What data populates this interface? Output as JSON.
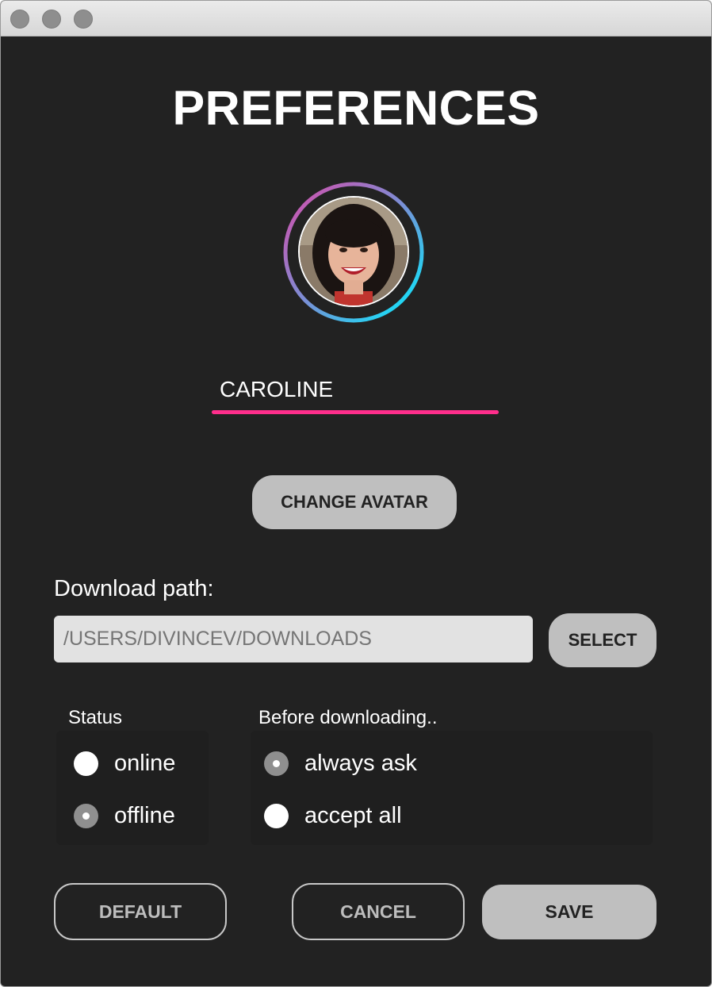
{
  "window": {
    "title": "PREFERENCES"
  },
  "profile": {
    "name_value": "CAROLINE",
    "change_avatar_label": "CHANGE AVATAR",
    "ring_colors": [
      "#c85ab0",
      "#00e5ff"
    ],
    "underline_color": "#ff2e8c"
  },
  "download": {
    "label": "Download path:",
    "path_placeholder": "/USERS/DIVINCEV/DOWNLOADS",
    "select_label": "SELECT"
  },
  "status": {
    "label": "Status",
    "options": [
      {
        "label": "online",
        "selected": false
      },
      {
        "label": "offline",
        "selected": true
      }
    ]
  },
  "before_downloading": {
    "label": "Before downloading..",
    "options": [
      {
        "label": "always ask",
        "selected": true
      },
      {
        "label": "accept all",
        "selected": false
      }
    ]
  },
  "actions": {
    "default_label": "DEFAULT",
    "cancel_label": "CANCEL",
    "save_label": "SAVE"
  }
}
